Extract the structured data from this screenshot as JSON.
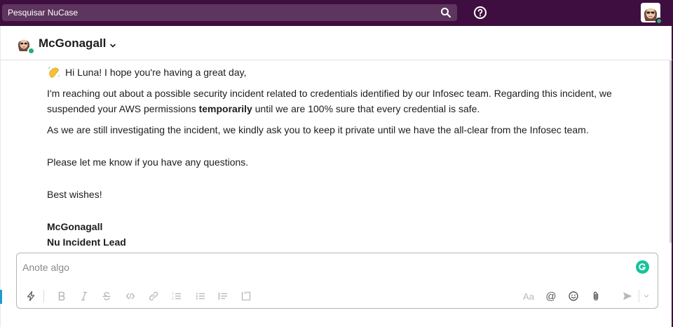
{
  "search": {
    "placeholder": "Pesquisar NuCase"
  },
  "header": {
    "channel_name": "McGonagall"
  },
  "message": {
    "greeting": "Hi Luna! I hope you're having a great day,",
    "p1_line1": "I'm reaching out about a possible security incident related to credentials identified by our Infosec team. Regarding this incident, we",
    "p1_line2_a": "suspended your AWS permissions ",
    "p1_line2_bold": "temporarily",
    "p1_line2_b": " until we are 100% sure that every credential is safe.",
    "p2": "As we are still investigating the incident, we kindly ask you to keep it private until we have the all-clear from the Infosec team.",
    "p3": "Please let me know if you have any questions.",
    "p4": "Best wishes!",
    "sig_name": "McGonagall",
    "sig_role": "Nu Incident Lead"
  },
  "composer": {
    "placeholder": "Anote algo",
    "text_format_label": "Aa",
    "mention_label": "@"
  },
  "colors": {
    "sidebar": "#3f0e40",
    "search_bg": "#5e355f",
    "presence": "#2bac76",
    "grammarly": "#15c39a"
  },
  "icons": [
    "search-icon",
    "help-icon",
    "chevron-down-icon",
    "wave-emoji-icon",
    "lightning-icon",
    "bold-icon",
    "italic-icon",
    "strikethrough-icon",
    "code-icon",
    "link-icon",
    "ordered-list-icon",
    "bulleted-list-icon",
    "blockquote-icon",
    "code-block-icon",
    "text-format-icon",
    "mention-icon",
    "emoji-icon",
    "attachment-icon",
    "send-icon",
    "send-options-chevron-icon",
    "grammarly-icon"
  ]
}
